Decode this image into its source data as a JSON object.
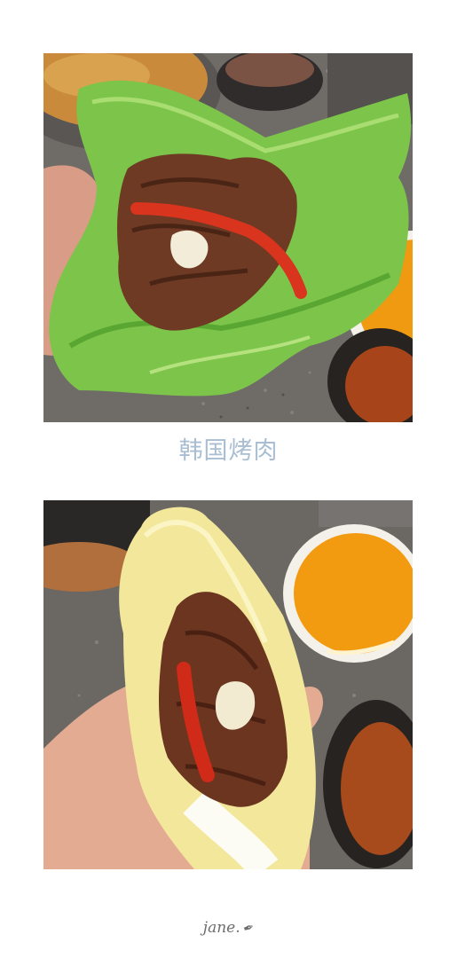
{
  "caption": "韩国烤肉",
  "signature": "jane.",
  "images": {
    "top": {
      "icon": "lettuce-wrap-photo"
    },
    "bottom": {
      "icon": "cabbage-wrap-photo"
    }
  },
  "colors": {
    "caption": "#a9bed2",
    "signature": "#6d6d6d",
    "background": "#ffffff"
  }
}
